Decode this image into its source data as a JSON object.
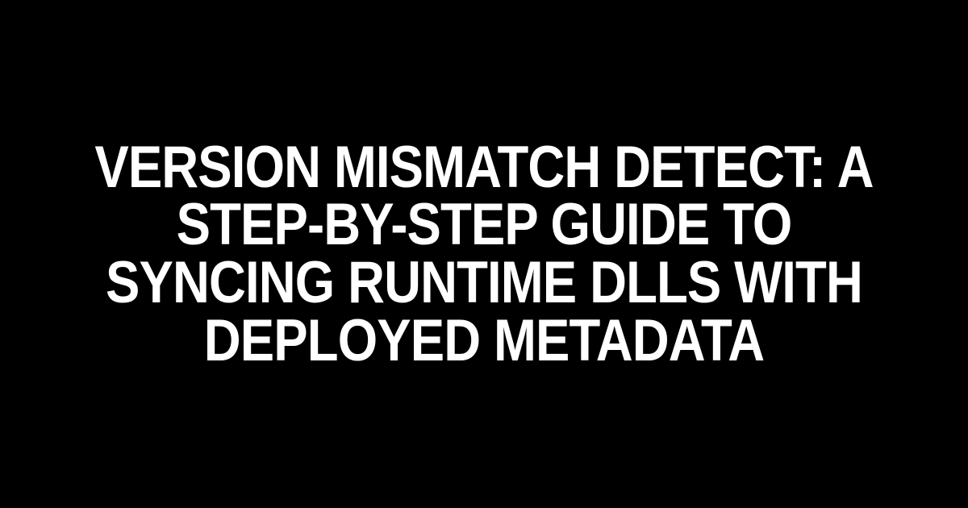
{
  "title": "Version Mismatch Detect: A Step-by-Step Guide to Syncing Runtime DLLs with Deployed Metadata"
}
